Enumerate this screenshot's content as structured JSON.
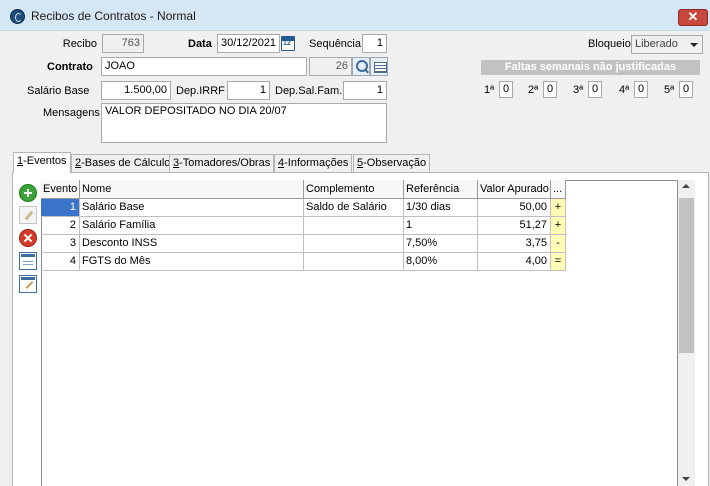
{
  "window": {
    "title": "Recibos de Contratos - Normal",
    "close_glyph": "✕"
  },
  "form": {
    "recibo_label": "Recibo",
    "recibo_value": "763",
    "data_label": "Data",
    "data_value": "30/12/2021",
    "calendar_glyph": "12",
    "sequencia_label": "Sequência",
    "sequencia_value": "1",
    "bloqueio_label": "Bloqueio",
    "bloqueio_value": "Liberado",
    "contrato_label": "Contrato",
    "contrato_value": "JOAO",
    "contrato_code": "26",
    "salario_base_label": "Salário Base",
    "salario_base_value": "1.500,00",
    "dep_irrf_label": "Dep.IRRF",
    "dep_irrf_value": "1",
    "dep_salfam_label": "Dep.Sal.Fam.",
    "dep_salfam_value": "1",
    "mensagens_label": "Mensagens",
    "mensagens_value": "VALOR DEPOSITADO NO DIA 20/07"
  },
  "faltas": {
    "header": "Faltas semanais não justificadas",
    "weeks": [
      {
        "label": "1ª",
        "value": "0"
      },
      {
        "label": "2ª",
        "value": "0"
      },
      {
        "label": "3ª",
        "value": "0"
      },
      {
        "label": "4ª",
        "value": "0"
      },
      {
        "label": "5ª",
        "value": "0"
      }
    ]
  },
  "tabs": [
    {
      "key": "1",
      "label": "-Eventos"
    },
    {
      "key": "2",
      "label": "-Bases de Cálculo"
    },
    {
      "key": "3",
      "label": "-Tomadores/Obras"
    },
    {
      "key": "4",
      "label": "-Informações"
    },
    {
      "key": "5",
      "label": "-Observação"
    }
  ],
  "side_toolbar": [
    "add-icon",
    "edit-icon",
    "delete-icon",
    "grid-icon",
    "grid-edit-icon"
  ],
  "grid": {
    "columns": [
      "Evento",
      "Nome",
      "Complemento",
      "Referência",
      "Valor Apurado",
      "..."
    ],
    "rows": [
      {
        "evento": "1",
        "nome": "Salário Base",
        "complemento": "Saldo de Salário",
        "referencia": "1/30 dias",
        "valor": "50,00",
        "sinal": "+"
      },
      {
        "evento": "2",
        "nome": "Salário Família",
        "complemento": "",
        "referencia": "1",
        "valor": "51,27",
        "sinal": "+"
      },
      {
        "evento": "3",
        "nome": "Desconto INSS",
        "complemento": "",
        "referencia": "7,50%",
        "valor": "3,75",
        "sinal": "-"
      },
      {
        "evento": "4",
        "nome": "FGTS do Mês",
        "complemento": "",
        "referencia": "8,00%",
        "valor": "4,00",
        "sinal": "="
      }
    ]
  },
  "colors": {
    "titlebar": "#d5e6f5",
    "close": "#c7483d",
    "selection": "#3a74c9",
    "sign_cell": "#fffcb6",
    "faltas_header": "#c2c2c2"
  }
}
